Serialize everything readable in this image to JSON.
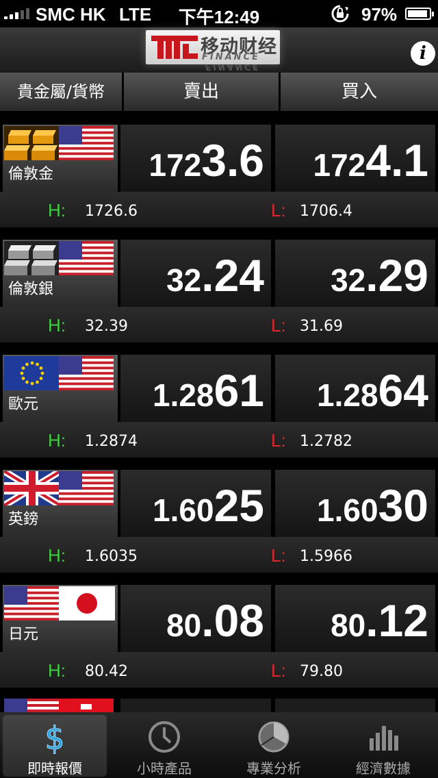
{
  "status": {
    "carrier": "SMC HK",
    "network": "LTE",
    "time": "下午12:49",
    "battery": "97%"
  },
  "header": {
    "logo_cn": "移动财经",
    "logo_en": "FINANCE"
  },
  "columns": {
    "instrument": "貴金屬/貨幣",
    "sell": "賣出",
    "buy": "買入"
  },
  "quotes": [
    {
      "name": "倫敦金",
      "sell_small": "172",
      "sell_big": "3.6",
      "buy_small": "172",
      "buy_big": "4.1",
      "high_label": "H:",
      "high": "1726.6",
      "low_label": "L:",
      "low": "1706.4"
    },
    {
      "name": "倫敦銀",
      "sell_small": "32",
      "sell_big": ".24",
      "buy_small": "32",
      "buy_big": ".29",
      "high_label": "H:",
      "high": "32.39",
      "low_label": "L:",
      "low": "31.69"
    },
    {
      "name": "歐元",
      "sell_small": "1.28",
      "sell_big": "61",
      "buy_small": "1.28",
      "buy_big": "64",
      "high_label": "H:",
      "high": "1.2874",
      "low_label": "L:",
      "low": "1.2782"
    },
    {
      "name": "英鎊",
      "sell_small": "1.60",
      "sell_big": "25",
      "buy_small": "1.60",
      "buy_big": "30",
      "high_label": "H:",
      "high": "1.6035",
      "low_label": "L:",
      "low": "1.5966"
    },
    {
      "name": "日元",
      "sell_small": "80",
      "sell_big": ".08",
      "buy_small": "80",
      "buy_big": ".12",
      "high_label": "H:",
      "high": "80.42",
      "low_label": "L:",
      "low": "79.80"
    }
  ],
  "tabs": [
    {
      "label": "即時報價",
      "icon": "dollar-icon"
    },
    {
      "label": "小時產品",
      "icon": "clock-icon"
    },
    {
      "label": "專業分析",
      "icon": "pie-chart-icon"
    },
    {
      "label": "經濟數據",
      "icon": "bar-chart-icon"
    }
  ],
  "colors": {
    "high": "#3fcf3f",
    "low": "#e0282c",
    "active_tab_icon": "#2aa0e0"
  }
}
